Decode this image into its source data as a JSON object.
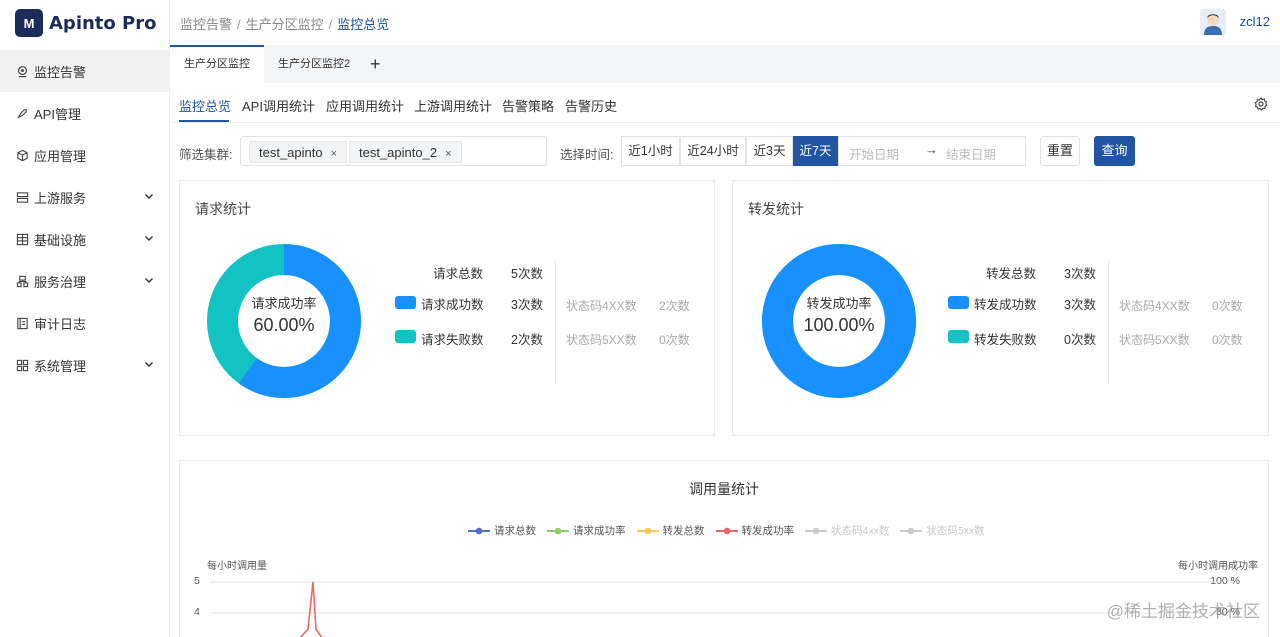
{
  "app": {
    "logo_mark": "M",
    "name": "Apinto Pro"
  },
  "sidebar": {
    "items": [
      {
        "label": "监控告警",
        "icon": "location-pin-icon",
        "active": true,
        "expandable": false
      },
      {
        "label": "API管理",
        "icon": "rocket-icon",
        "expandable": false
      },
      {
        "label": "应用管理",
        "icon": "cube-icon",
        "expandable": false
      },
      {
        "label": "上游服务",
        "icon": "server-icon",
        "expandable": true
      },
      {
        "label": "基础设施",
        "icon": "database-icon",
        "expandable": true
      },
      {
        "label": "服务治理",
        "icon": "cluster-icon",
        "expandable": true
      },
      {
        "label": "审计日志",
        "icon": "log-icon",
        "expandable": false
      },
      {
        "label": "系统管理",
        "icon": "grid-icon",
        "expandable": true
      }
    ]
  },
  "header": {
    "breadcrumb": [
      "监控告警",
      "生产分区监控",
      "监控总览"
    ],
    "separator": "/",
    "username": "zcl12"
  },
  "tabs": {
    "items": [
      {
        "label": "生产分区监控",
        "active": true
      },
      {
        "label": "生产分区监控2",
        "active": false
      }
    ],
    "add_label": "+"
  },
  "subnav": {
    "items": [
      {
        "label": "监控总览",
        "active": true
      },
      {
        "label": "API调用统计"
      },
      {
        "label": "应用调用统计"
      },
      {
        "label": "上游调用统计"
      },
      {
        "label": "告警策略"
      },
      {
        "label": "告警历史"
      }
    ]
  },
  "filter": {
    "cluster_label": "筛选集群:",
    "clusters": [
      "test_apinto",
      "test_apinto_2"
    ],
    "chip_close": "×",
    "time_label": "选择时间:",
    "time_options": [
      {
        "label": "近1小时"
      },
      {
        "label": "近24小时"
      },
      {
        "label": "近3天"
      },
      {
        "label": "近7天",
        "active": true
      }
    ],
    "start_placeholder": "开始日期",
    "end_placeholder": "结束日期",
    "date_arrow": "→",
    "reset_label": "重置",
    "query_label": "查询"
  },
  "request_card": {
    "title": "请求统计",
    "donut_label": "请求成功率",
    "donut_value": "60.00%",
    "success_fraction": 0.6,
    "total_label": "请求总数",
    "total_value": "5次数",
    "success_label": "请求成功数",
    "success_value": "3次数",
    "fail_label": "请求失败数",
    "fail_value": "2次数",
    "code4_label": "状态码4XX数",
    "code4_value": "2次数",
    "code5_label": "状态码5XX数",
    "code5_value": "0次数"
  },
  "forward_card": {
    "title": "转发统计",
    "donut_label": "转发成功率",
    "donut_value": "100.00%",
    "success_fraction": 1.0,
    "total_label": "转发总数",
    "total_value": "3次数",
    "success_label": "转发成功数",
    "success_value": "3次数",
    "fail_label": "转发失败数",
    "fail_value": "0次数",
    "code4_label": "状态码4XX数",
    "code4_value": "0次数",
    "code5_label": "状态码5XX数",
    "code5_value": "0次数"
  },
  "colors": {
    "primary": "#2155a3",
    "donut_blue": "#1890ff",
    "donut_teal": "#13c2c2"
  },
  "chart_data": {
    "type": "line",
    "title": "调用量统计",
    "series": [
      {
        "name": "请求总数",
        "color": "#5470c6"
      },
      {
        "name": "请求成功率",
        "color": "#91cc75"
      },
      {
        "name": "转发总数",
        "color": "#fac858"
      },
      {
        "name": "转发成功率",
        "color": "#ee6666"
      },
      {
        "name": "状态码4xx数",
        "color": "#cccccc",
        "disabled": true
      },
      {
        "name": "状态码5xx数",
        "color": "#cccccc",
        "disabled": true
      }
    ],
    "ylabel_left": "每小时调用量",
    "ylabel_right": "每小时调用成功率",
    "y_ticks_visible": [
      "5",
      "4"
    ],
    "y_right_ticks_visible": [
      "100 %",
      "80 %"
    ],
    "legend_placement": "top-center"
  },
  "watermark": "@稀土掘金技术社区"
}
